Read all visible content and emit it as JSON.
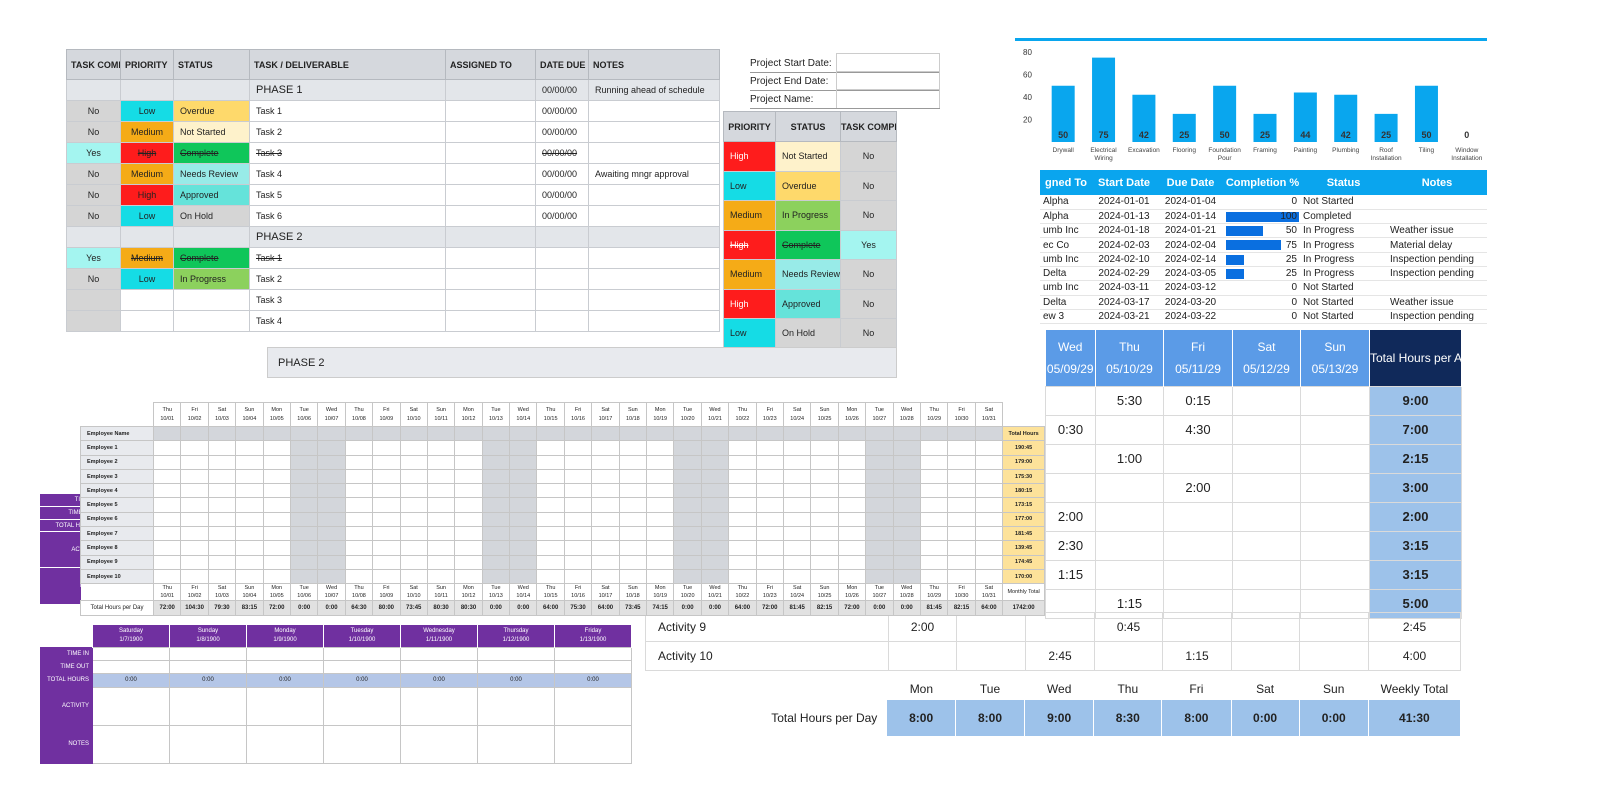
{
  "task_list": {
    "headers": [
      "TASK COMPLETE?",
      "PRIORITY",
      "STATUS",
      "TASK  / DELIVERABLE",
      "ASSIGNED TO",
      "DATE DUE",
      "NOTES"
    ],
    "rows": [
      {
        "phase": "PHASE 1",
        "due": "00/00/00",
        "notes": "Running ahead of schedule"
      },
      {
        "complete": "No",
        "priority": "Low",
        "pc": "cy",
        "status": "Overdue",
        "sc": "s-over",
        "task": "Task 1",
        "due": "00/00/00",
        "notes": ""
      },
      {
        "complete": "No",
        "priority": "Medium",
        "pc": "or",
        "status": "Not Started",
        "sc": "s-ns",
        "task": "Task 2",
        "due": "00/00/00",
        "notes": ""
      },
      {
        "complete": "Yes",
        "priority": "High",
        "pc": "rd",
        "status": "Complete",
        "sc": "s-comp",
        "task": "Task 3",
        "due": "00/00/00",
        "notes": "",
        "strike": true
      },
      {
        "complete": "No",
        "priority": "Medium",
        "pc": "or",
        "status": "Needs Review",
        "sc": "s-nr",
        "task": "Task 4",
        "due": "00/00/00",
        "notes": "Awaiting mngr approval"
      },
      {
        "complete": "No",
        "priority": "High",
        "pc": "rd",
        "status": "Approved",
        "sc": "s-app",
        "task": "Task 5",
        "due": "00/00/00",
        "notes": ""
      },
      {
        "complete": "No",
        "priority": "Low",
        "pc": "cy",
        "status": "On Hold",
        "sc": "s-hold",
        "task": "Task 6",
        "due": "00/00/00",
        "notes": ""
      },
      {
        "phase": "PHASE 2",
        "due": "",
        "notes": ""
      },
      {
        "complete": "Yes",
        "priority": "Medium",
        "pc": "or",
        "status": "Complete",
        "sc": "s-comp",
        "task": "Task 1",
        "due": "",
        "notes": "",
        "strike": true
      },
      {
        "complete": "No",
        "priority": "Low",
        "pc": "cy",
        "status": "In Progress",
        "sc": "s-ip",
        "task": "Task 2",
        "due": "",
        "notes": ""
      },
      {
        "complete": "",
        "priority": "",
        "pc": "",
        "status": "",
        "sc": "",
        "task": "Task 3",
        "due": "",
        "notes": ""
      },
      {
        "complete": "",
        "priority": "",
        "pc": "",
        "status": "",
        "sc": "",
        "task": "Task 4",
        "due": "",
        "notes": ""
      }
    ]
  },
  "project_info": [
    "Project Start Date:",
    "Project End Date:",
    "Project Name:"
  ],
  "legend": {
    "headers": [
      "PRIORITY",
      "STATUS",
      "TASK COMPLETE?"
    ],
    "rows": [
      {
        "p": "High",
        "pc": "rd",
        "s": "Not Started",
        "sc": "s-ns",
        "c": "No"
      },
      {
        "p": "Low",
        "pc": "cy",
        "s": "Overdue",
        "sc": "s-over",
        "c": "No"
      },
      {
        "p": "Medium",
        "pc": "or",
        "s": "In Progress",
        "sc": "s-ip",
        "c": "No"
      },
      {
        "p": "High",
        "pc": "rd",
        "s": "Complete",
        "sc": "s-comp",
        "c": "Yes",
        "strike": true
      },
      {
        "p": "Medium",
        "pc": "or",
        "s": "Needs Review",
        "sc": "s-nr",
        "c": "No"
      },
      {
        "p": "High",
        "pc": "rd",
        "s": "Approved",
        "sc": "s-app",
        "c": "No"
      },
      {
        "p": "Low",
        "pc": "cy",
        "s": "On Hold",
        "sc": "s-hold",
        "c": "No"
      }
    ]
  },
  "chart_data": {
    "type": "bar",
    "categories": [
      "Drywall",
      "Electrical Wiring",
      "Excavation",
      "Flooring",
      "Foundation Pour",
      "Framing",
      "Painting",
      "Plumbing",
      "Roof Installation",
      "Tiling",
      "Window Installation"
    ],
    "values": [
      50,
      75,
      42,
      25,
      50,
      25,
      44,
      42,
      25,
      50,
      0
    ],
    "ylim": [
      0,
      80
    ],
    "yticks": [
      20,
      40,
      60,
      80
    ],
    "color": "#09a6ee"
  },
  "gantt": {
    "headers": [
      "gned To",
      "Start Date",
      "Due Date",
      "Completion %",
      "Status",
      "Notes"
    ],
    "rows": [
      [
        "Alpha",
        "2024-01-01",
        "2024-01-04",
        0,
        "Not Started",
        ""
      ],
      [
        "Alpha",
        "2024-01-13",
        "2024-01-14",
        100,
        "Completed",
        ""
      ],
      [
        "umb Inc",
        "2024-01-18",
        "2024-01-21",
        50,
        "In Progress",
        "Weather issue"
      ],
      [
        "ec Co",
        "2024-02-03",
        "2024-02-04",
        75,
        "In Progress",
        "Material delay"
      ],
      [
        "umb Inc",
        "2024-02-10",
        "2024-02-14",
        25,
        "In Progress",
        "Inspection pending"
      ],
      [
        "Delta",
        "2024-02-29",
        "2024-03-05",
        25,
        "In Progress",
        "Inspection pending"
      ],
      [
        "umb Inc",
        "2024-03-11",
        "2024-03-12",
        0,
        "Not Started",
        ""
      ],
      [
        "Delta",
        "2024-03-17",
        "2024-03-20",
        0,
        "Not Started",
        "Weather issue"
      ],
      [
        "ew 3",
        "2024-03-21",
        "2024-03-22",
        0,
        "Not Started",
        "Inspection pending"
      ]
    ]
  },
  "phase2_label": "PHASE 2",
  "timesheet": {
    "name_header": "Employee Name",
    "days": [
      "Thu",
      "Fri",
      "Sat",
      "Sun",
      "Mon",
      "Tue",
      "Wed",
      "Thu",
      "Fri",
      "Sat",
      "Sun",
      "Mon",
      "Tue",
      "Wed",
      "Thu",
      "Fri",
      "Sat",
      "Sun",
      "Mon",
      "Tue",
      "Wed",
      "Thu",
      "Fri",
      "Sat",
      "Sun",
      "Mon",
      "Tue",
      "Wed",
      "Thu",
      "Fri",
      "Sat"
    ],
    "dates": [
      "10/01",
      "10/02",
      "10/03",
      "10/04",
      "10/05",
      "10/06",
      "10/07",
      "10/08",
      "10/09",
      "10/10",
      "10/11",
      "10/12",
      "10/13",
      "10/14",
      "10/15",
      "10/16",
      "10/17",
      "10/18",
      "10/19",
      "10/20",
      "10/21",
      "10/22",
      "10/23",
      "10/24",
      "10/25",
      "10/26",
      "10/27",
      "10/28",
      "10/29",
      "10/30",
      "10/31"
    ],
    "total_header": "Total Hours",
    "employees": [
      {
        "name": "Employee 1",
        "total": "190:45"
      },
      {
        "name": "Employee 2",
        "total": "179:00"
      },
      {
        "name": "Employee 3",
        "total": "175:30"
      },
      {
        "name": "Employee 4",
        "total": "180:15"
      },
      {
        "name": "Employee 5",
        "total": "173:15"
      },
      {
        "name": "Employee 6",
        "total": "177:00"
      },
      {
        "name": "Employee 7",
        "total": "181:45"
      },
      {
        "name": "Employee 8",
        "total": "139:45"
      },
      {
        "name": "Employee 9",
        "total": "174:45"
      },
      {
        "name": "Employee 10",
        "total": "170:00"
      }
    ],
    "footer_label": "Total Hours per Day",
    "monthly_label": "Monthly Total",
    "day_totals": [
      "72:00",
      "104:30",
      "79:30",
      "83:15",
      "72:00",
      "0:00",
      "0:00",
      "64:30",
      "80:00",
      "73:45",
      "80:30",
      "80:30",
      "0:00",
      "0:00",
      "64:00",
      "75:30",
      "64:00",
      "73:45",
      "74:15",
      "0:00",
      "0:00",
      "64:00",
      "72:00",
      "81:45",
      "82:15",
      "72:00",
      "0:00",
      "0:00",
      "81:45",
      "82:15",
      "64:00"
    ],
    "monthly_total": "1742:00"
  },
  "weekly": {
    "headers": [
      [
        "Wed",
        "05/09/29"
      ],
      [
        "Thu",
        "05/10/29"
      ],
      [
        "Fri",
        "05/11/29"
      ],
      [
        "Sat",
        "05/12/29"
      ],
      [
        "Sun",
        "05/13/29"
      ]
    ],
    "total_header": "Total Hours per Activity",
    "rows": [
      [
        "",
        "5:30",
        "0:15",
        "",
        "",
        "9:00"
      ],
      [
        "0:30",
        "",
        "4:30",
        "",
        "",
        "7:00"
      ],
      [
        "",
        "1:00",
        "",
        "",
        "",
        "2:15"
      ],
      [
        "",
        "",
        "2:00",
        "",
        "",
        "3:00"
      ],
      [
        "2:00",
        "",
        "",
        "",
        "",
        "2:00"
      ],
      [
        "2:30",
        "",
        "",
        "",
        "",
        "3:15"
      ],
      [
        "1:15",
        "",
        "",
        "",
        "",
        "3:15"
      ],
      [
        "",
        "1:15",
        "",
        "",
        "",
        "5:00"
      ],
      [
        "",
        "0:45",
        "",
        "",
        "",
        "2:45"
      ],
      [
        "2:45",
        "",
        "1:15",
        "",
        "",
        "4:00"
      ]
    ],
    "activities": [
      {
        "name": "Activity 9",
        "mon": "2:00"
      },
      {
        "name": "Activity 10",
        "mon": ""
      }
    ],
    "summary": {
      "label": "Total Hours per Day",
      "days": [
        "Mon",
        "Tue",
        "Wed",
        "Thu",
        "Fri",
        "Sat",
        "Sun",
        "Weekly Total"
      ],
      "values": [
        "8:00",
        "8:00",
        "9:00",
        "8:30",
        "8:00",
        "0:00",
        "0:00",
        "41:30"
      ]
    }
  },
  "purple": {
    "side": [
      "TIME",
      "TIME O",
      "TOTAL HOU",
      "ACTIV",
      "NO"
    ],
    "days": [
      [
        "Saturday",
        "1/7/1900"
      ],
      [
        "Sunday",
        "1/8/1900"
      ],
      [
        "Monday",
        "1/9/1900"
      ],
      [
        "Tuesday",
        "1/10/1900"
      ],
      [
        "Wednesday",
        "1/11/1900"
      ],
      [
        "Thursday",
        "1/12/1900"
      ],
      [
        "Friday",
        "1/13/1900"
      ]
    ],
    "row_labels": [
      "TIME IN",
      "TIME OUT",
      "TOTAL HOURS",
      "ACTIVITY",
      "NOTES"
    ],
    "total": "0:00"
  }
}
